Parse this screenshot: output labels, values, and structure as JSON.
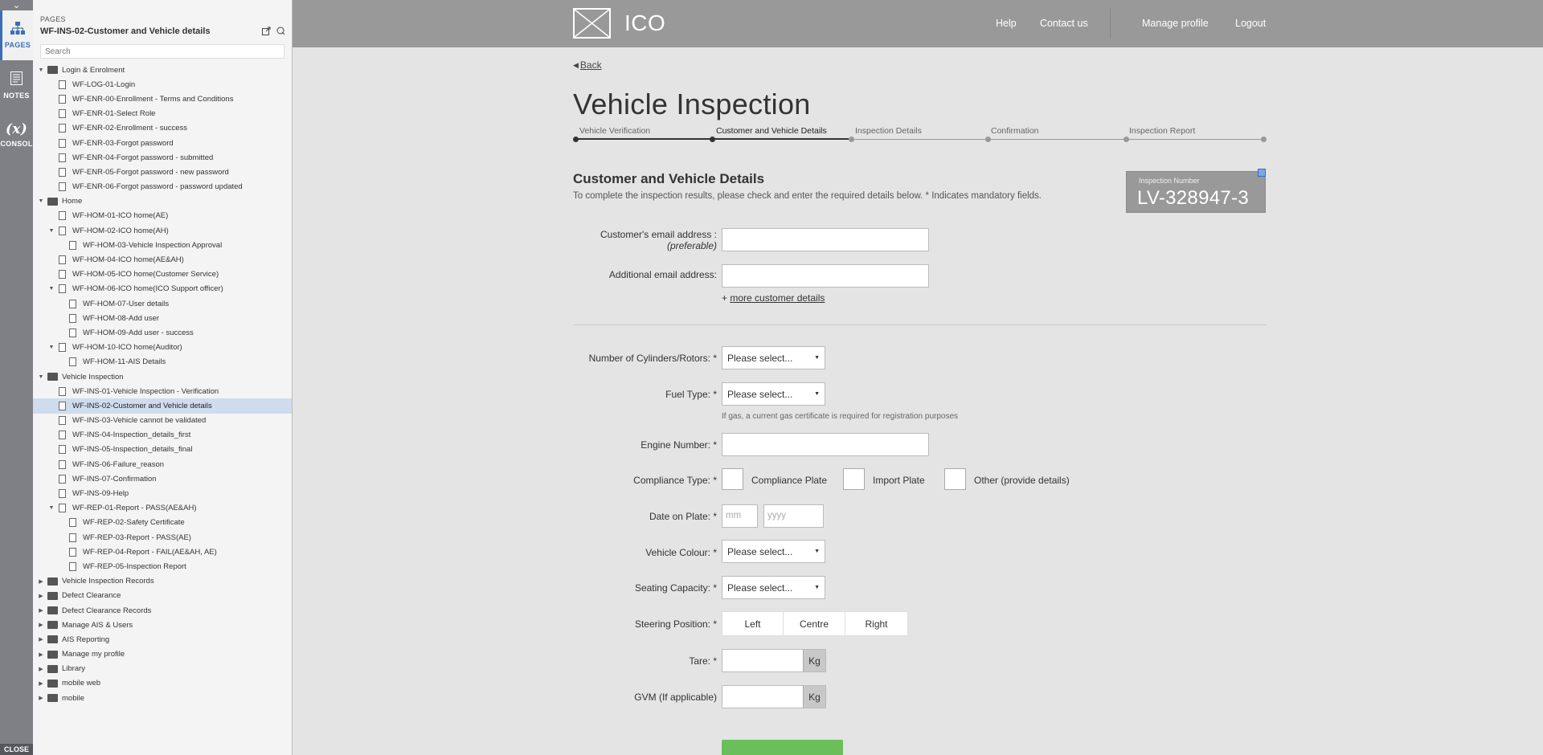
{
  "rail": {
    "items": [
      {
        "label": "PAGES",
        "icon": "sitemap-icon"
      },
      {
        "label": "NOTES",
        "icon": "notes-icon"
      },
      {
        "label": "CONSOL",
        "icon": "variable-icon",
        "glyph": "(x)"
      }
    ],
    "close_label": "CLOSE",
    "toggle_glyph": "⌄"
  },
  "sidebar": {
    "section_label": "PAGES",
    "current_page": "WF-INS-02-Customer and Vehicle details",
    "search_placeholder": "Search",
    "tree": [
      {
        "label": "Login & Enrolment",
        "type": "folder",
        "level": 0,
        "arrow": "▼"
      },
      {
        "label": "WF-LOG-01-Login",
        "type": "page",
        "level": 1,
        "arrow": ""
      },
      {
        "label": "WF-ENR-00-Enrollment - Terms and Conditions",
        "type": "page",
        "level": 1,
        "arrow": ""
      },
      {
        "label": "WF-ENR-01-Select Role",
        "type": "page",
        "level": 1,
        "arrow": ""
      },
      {
        "label": "WF-ENR-02-Enrollment - success",
        "type": "page",
        "level": 1,
        "arrow": ""
      },
      {
        "label": "WF-ENR-03-Forgot password",
        "type": "page",
        "level": 1,
        "arrow": ""
      },
      {
        "label": "WF-ENR-04-Forgot password - submitted",
        "type": "page",
        "level": 1,
        "arrow": ""
      },
      {
        "label": "WF-ENR-05-Forgot password - new password",
        "type": "page",
        "level": 1,
        "arrow": ""
      },
      {
        "label": "WF-ENR-06-Forgot password - password updated",
        "type": "page",
        "level": 1,
        "arrow": ""
      },
      {
        "label": "Home",
        "type": "folder",
        "level": 0,
        "arrow": "▼"
      },
      {
        "label": "WF-HOM-01-ICO home(AE)",
        "type": "page",
        "level": 1,
        "arrow": ""
      },
      {
        "label": "WF-HOM-02-ICO home(AH)",
        "type": "page",
        "level": 1,
        "arrow": "▼"
      },
      {
        "label": "WF-HOM-03-Vehicle Inspection Approval",
        "type": "page",
        "level": 2,
        "arrow": ""
      },
      {
        "label": "WF-HOM-04-ICO home(AE&AH)",
        "type": "page",
        "level": 1,
        "arrow": ""
      },
      {
        "label": "WF-HOM-05-ICO home(Customer Service)",
        "type": "page",
        "level": 1,
        "arrow": ""
      },
      {
        "label": "WF-HOM-06-ICO home(ICO Support officer)",
        "type": "page",
        "level": 1,
        "arrow": "▼"
      },
      {
        "label": "WF-HOM-07-User details",
        "type": "page",
        "level": 2,
        "arrow": ""
      },
      {
        "label": "WF-HOM-08-Add user",
        "type": "page",
        "level": 2,
        "arrow": ""
      },
      {
        "label": "WF-HOM-09-Add user - success",
        "type": "page",
        "level": 2,
        "arrow": ""
      },
      {
        "label": "WF-HOM-10-ICO home(Auditor)",
        "type": "page",
        "level": 1,
        "arrow": "▼"
      },
      {
        "label": "WF-HOM-11-AIS Details",
        "type": "page",
        "level": 2,
        "arrow": ""
      },
      {
        "label": "Vehicle Inspection",
        "type": "folder",
        "level": 0,
        "arrow": "▼"
      },
      {
        "label": "WF-INS-01-Vehicle Inspection - Verification",
        "type": "page",
        "level": 1,
        "arrow": ""
      },
      {
        "label": "WF-INS-02-Customer and Vehicle details",
        "type": "page",
        "level": 1,
        "arrow": "",
        "selected": true
      },
      {
        "label": "WF-INS-03-Vehicle cannot be validated",
        "type": "page",
        "level": 1,
        "arrow": ""
      },
      {
        "label": "WF-INS-04-Inspection_details_first",
        "type": "page",
        "level": 1,
        "arrow": ""
      },
      {
        "label": "WF-INS-05-Inspection_details_final",
        "type": "page",
        "level": 1,
        "arrow": ""
      },
      {
        "label": "WF-INS-06-Failure_reason",
        "type": "page",
        "level": 1,
        "arrow": ""
      },
      {
        "label": "WF-INS-07-Confirmation",
        "type": "page",
        "level": 1,
        "arrow": ""
      },
      {
        "label": "WF-INS-09-Help",
        "type": "page",
        "level": 1,
        "arrow": ""
      },
      {
        "label": "WF-REP-01-Report - PASS(AE&AH)",
        "type": "page",
        "level": 1,
        "arrow": "▼"
      },
      {
        "label": "WF-REP-02-Safety Certificate",
        "type": "page",
        "level": 2,
        "arrow": ""
      },
      {
        "label": "WF-REP-03-Report - PASS(AE)",
        "type": "page",
        "level": 2,
        "arrow": ""
      },
      {
        "label": "WF-REP-04-Report - FAIL(AE&AH, AE)",
        "type": "page",
        "level": 2,
        "arrow": ""
      },
      {
        "label": "WF-REP-05-Inspection Report",
        "type": "page",
        "level": 2,
        "arrow": ""
      },
      {
        "label": "Vehicle Inspection Records",
        "type": "folder",
        "level": 0,
        "arrow": "▶"
      },
      {
        "label": "Defect Clearance",
        "type": "folder",
        "level": 0,
        "arrow": "▶"
      },
      {
        "label": "Defect Clearance Records",
        "type": "folder",
        "level": 0,
        "arrow": "▶"
      },
      {
        "label": "Manage AIS & Users",
        "type": "folder",
        "level": 0,
        "arrow": "▶"
      },
      {
        "label": "AIS Reporting",
        "type": "folder",
        "level": 0,
        "arrow": "▶"
      },
      {
        "label": "Manage my profile",
        "type": "folder",
        "level": 0,
        "arrow": "▶"
      },
      {
        "label": "Library",
        "type": "folder",
        "level": 0,
        "arrow": "▶"
      },
      {
        "label": "mobile web",
        "type": "folder",
        "level": 0,
        "arrow": "▶"
      },
      {
        "label": "mobile",
        "type": "folder",
        "level": 0,
        "arrow": "▶"
      }
    ]
  },
  "topbar": {
    "logo_text": "ICO",
    "nav": [
      "Help",
      "Contact us",
      "Manage profile",
      "Logout"
    ]
  },
  "page": {
    "back_label": "Back",
    "title": "Vehicle Inspection",
    "steps": [
      {
        "label": "Vehicle Verification",
        "done": true
      },
      {
        "label": "Customer and Vehicle Details",
        "done": true,
        "current": true
      },
      {
        "label": "Inspection Details",
        "done": false
      },
      {
        "label": "Confirmation",
        "done": false
      },
      {
        "label": "Inspection Report",
        "done": false
      }
    ],
    "section_title": "Customer and Vehicle Details",
    "section_desc": "To complete the inspection results, please check and enter the required details below.  * Indicates mandatory fields.",
    "inspection": {
      "caption": "Inspection Number",
      "number": "LV-328947-3"
    },
    "form": {
      "email_label": "Customer's email address :",
      "email_sub": "(preferable)",
      "email_value": "",
      "additional_email_label": "Additional email address:",
      "additional_email_value": "",
      "more_prefix": "+ ",
      "more_link": "more customer details",
      "cylinders_label": "Number of Cylinders/Rotors: *",
      "cylinders_value": "Please select...",
      "fuel_label": "Fuel Type: *",
      "fuel_value": "Please select...",
      "fuel_hint": "If gas, a current gas certificate is required for registration purposes",
      "engine_label": "Engine Number: *",
      "engine_value": "",
      "compliance_label": "Compliance Type: *",
      "compliance_options": [
        "Compliance Plate",
        "Import Plate",
        "Other (provide details)"
      ],
      "date_label": "Date on Plate: *",
      "date_mm_placeholder": "mm",
      "date_yyyy_placeholder": "yyyy",
      "colour_label": "Vehicle Colour: *",
      "colour_value": "Please select...",
      "seating_label": "Seating Capacity: *",
      "seating_value": "Please select...",
      "steering_label": "Steering Position: *",
      "steering_options": [
        "Left",
        "Centre",
        "Right"
      ],
      "tare_label": "Tare: *",
      "tare_unit": "Kg",
      "gvm_label": "GVM (If applicable)",
      "gvm_unit": "Kg"
    }
  }
}
